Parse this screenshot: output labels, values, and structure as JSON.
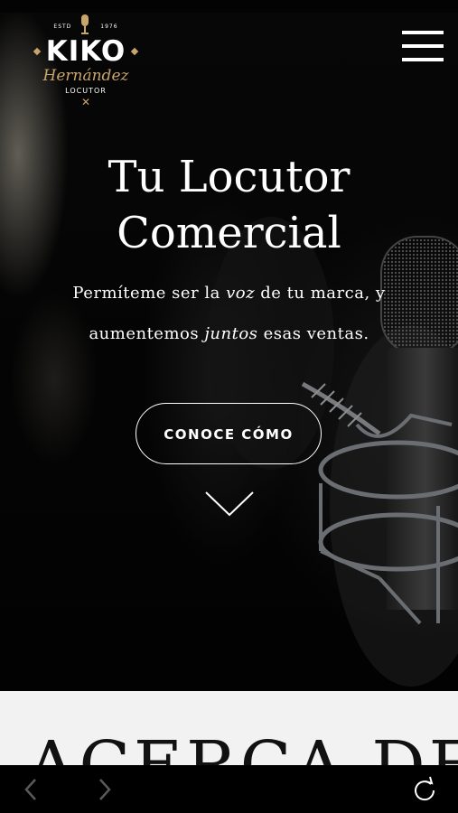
{
  "logo": {
    "estd": "ESTD",
    "year": "1976",
    "name": "KIKO",
    "script": "Hernández",
    "role": "LOCUTOR",
    "mark": "✕"
  },
  "header": {
    "menu_icon": "hamburger-menu-icon"
  },
  "hero": {
    "title_line1": "Tu Locutor",
    "title_line2": "Comercial",
    "tagline": {
      "p1": "Permíteme ser la ",
      "em1": "voz",
      "p2": " de tu marca, y",
      "p3": "aumentemos ",
      "em2": "juntos",
      "p4": " esas ventas."
    },
    "cta_label": "CONOCE CÓMO",
    "scroll_icon": "chevron-down-icon"
  },
  "about": {
    "heading": "ACERCA DE"
  },
  "browser": {
    "back_icon": "back-arrow-icon",
    "forward_icon": "forward-arrow-icon",
    "reload_icon": "reload-icon"
  },
  "colors": {
    "accent_gold": "#c9a46b",
    "about_bg": "#f2f2f2",
    "hero_bg": "#050505"
  }
}
